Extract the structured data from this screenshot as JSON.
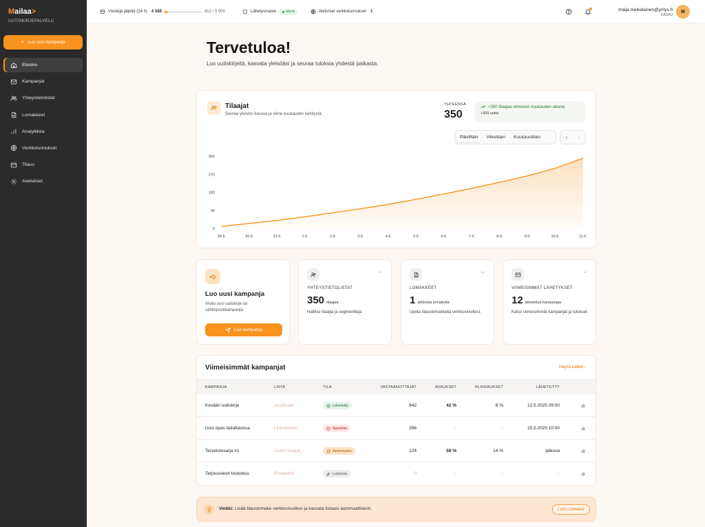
{
  "brand": {
    "name_m": "M",
    "name_rest": "ailaa",
    "chevron": ">",
    "subtitle": "UUTISKIRJEPALVELU"
  },
  "sidebar": {
    "new_campaign": "Luo uusi kampanja",
    "items": [
      {
        "label": "Etusivu",
        "icon": "home-icon",
        "active": true
      },
      {
        "label": "Kampanjat",
        "icon": "mail-icon"
      },
      {
        "label": "Yhteystietolistat",
        "icon": "users-icon"
      },
      {
        "label": "Lomakkeet",
        "icon": "file-icon"
      },
      {
        "label": "Analytiikka",
        "icon": "bar-chart-icon"
      },
      {
        "label": "Verkkotunnukset",
        "icon": "globe-icon"
      },
      {
        "label": "Tilaus",
        "icon": "credit-card-icon"
      },
      {
        "label": "Asetukset",
        "icon": "gear-icon"
      }
    ]
  },
  "topbar": {
    "quota_label": "Viestejä jäljellä (24 h)",
    "quota_value": "4 588",
    "quota_used": "412 / 5 000",
    "quota_fraction": 0.0824,
    "reputation_label": "Lähetysmaine",
    "reputation_value": "Hyvä",
    "domains_label": "Aktiiviset verkkotunnukset",
    "domains_value": "1",
    "user_email": "maija.meikalainen@yritys.fi",
    "user_role": "KASVU",
    "avatar_initial": "M"
  },
  "welcome": {
    "title": "Tervetuloa!",
    "subtitle": "Luo uutiskirjeitä, kasvata yleisöäsi ja seuraa tuloksia yhdestä paikasta."
  },
  "subscribers": {
    "title": "Tilaajat",
    "subtitle": "Seuraa yleisösi kasvua ja viime kuukauden kehitystä.",
    "total_label": "YHTEENSÄ",
    "total_value": "350",
    "growth_line1": "+350 tilaajaa viimeisen kuukauden aikana",
    "growth_line2": "+350 uutta",
    "tabs": [
      "Päivittäin",
      "Viikoittain",
      "Kuukausittain"
    ],
    "active_tab": 0,
    "prev": "‹",
    "next": "›"
  },
  "chart_data": {
    "type": "area",
    "x": [
      "29.5.",
      "30.5.",
      "31.5.",
      "1.6.",
      "2.6.",
      "3.6.",
      "4.6.",
      "5.6.",
      "6.6.",
      "7.6.",
      "8.6.",
      "9.6.",
      "10.6.",
      "11.6."
    ],
    "y_ticks": [
      0,
      90,
      180,
      270,
      360
    ],
    "ylim": [
      0,
      360
    ],
    "series": [
      {
        "values": [
          10,
          25,
          40,
          58,
          78,
          98,
          120,
          145,
          172,
          200,
          230,
          262,
          300,
          350
        ]
      }
    ],
    "color": "#f7931e",
    "grid": false
  },
  "cards": [
    {
      "label": "YHTEYSTIETOLISTAT",
      "value": "350",
      "unit": "tilaajaa",
      "desc": "Hallitse tilaajia ja segmenttejä.",
      "icon": "users-icon"
    },
    {
      "label": "LOMAKKEET",
      "value": "1",
      "unit": "aktiivista lomaketta",
      "desc": "Upota tilauslomakkeita verkkosivuillesi.",
      "icon": "file-icon"
    },
    {
      "label": "VIIMEISIMMÄT LÄHETYKSET",
      "value": "12",
      "unit": "lähetettyä kampanjaa",
      "desc": "Katso viimeisimmät kampanjat ja tulokset.",
      "icon": "mail-icon"
    }
  ],
  "create_card": {
    "title": "Luo uusi kampanja",
    "desc": "Aloita uusi uutiskirje tai sähköpostikampanja.",
    "button": "Luo kampanja"
  },
  "campaigns": {
    "title": "Viimeisimmät kampanjat",
    "show_all": "Näytä kaikki",
    "show_all_icon": "›",
    "headers": [
      "KAMPANJA",
      "LISTA",
      "TILA",
      "VASTAANOTTAJAT",
      "AVAUKSET",
      "KLIKKAUKSET",
      "LÄHETETTY"
    ],
    "rows": [
      {
        "name": "Kevään uutiskirje",
        "list": "Asiakkaat",
        "status": "Lähetetty",
        "status_type": "sent",
        "recipients": "842",
        "opens": "42 %",
        "clicks": "8 %",
        "sent": "12.5.2025 09:00"
      },
      {
        "name": "Uusi opas ladattavissa",
        "list": "Liidirekisteri",
        "status": "Ajastettu",
        "status_type": "sched",
        "recipients": "396",
        "opens": "–",
        "clicks": "–",
        "sent": "15.5.2025 10:00"
      },
      {
        "name": "Tervetulosarja #1",
        "list": "Uudet tilaajat",
        "status": "Automaatio",
        "status_type": "auto",
        "recipients": "124",
        "opens": "58 %",
        "clicks": "14 %",
        "sent": "jatkuva"
      },
      {
        "name": "Tarjousviesti toukokuu",
        "list": "Prospektit",
        "status": "Luonnos",
        "status_type": "draft",
        "recipients": "0",
        "opens": "–",
        "clicks": "–",
        "sent": "–"
      }
    ]
  },
  "tip": {
    "lead": "Vinkki:",
    "text": "Lisää tilauslomake verkkosivuillesi ja kasvata listaasi automaattisesti.",
    "button": "LUO LOMAKE"
  }
}
